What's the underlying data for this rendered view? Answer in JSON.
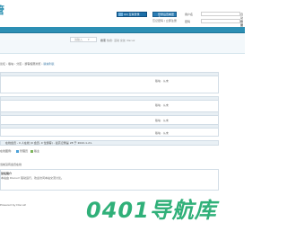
{
  "header": {
    "logo_char": "管",
    "qq_login_label": "QQ 互联登录",
    "mobile_label": "登录后查看更多",
    "small_links": "忘记密码 / 立即注册",
    "username_label": "用户名",
    "password_label": "密码",
    "remember_label": "自动登录",
    "forgot_label": "找回密码"
  },
  "subbar": {
    "search_placeholder": "请输入",
    "search_button": "搜索",
    "hot_label": "热搜:",
    "hot_terms": "活动 交友 discuz"
  },
  "breadcrumb": {
    "path": "论坛 › 版块 › 分区 › 游客权限浏览 ›",
    "current": "版块列表"
  },
  "forum_rows": [
    {
      "meta": "版块 ·   从未"
    },
    {
      "meta": "版块 ·   从未"
    },
    {
      "meta": "版块 ·   从未"
    },
    {
      "meta": "版块 ·   从未"
    }
  ],
  "stats": {
    "online_line": "在线会员 - 0 人在线 (0 会员, 0 位游客) - 最高记录是 28 于 2022-1-21.",
    "legend_label": "在线图例:",
    "legend_items": [
      {
        "label": "管理员",
        "color": "#4aa0d8"
      },
      {
        "label": "版主",
        "color": "#7cb45a"
      }
    ]
  },
  "section_label": "当前没有会员在线",
  "description": {
    "title": "论坛简介",
    "text": "本站由 Discuz! 驱动运行，欢迎访问本站交流讨论。"
  },
  "footer": {
    "text": "Powered by Discuz!"
  },
  "watermark": {
    "text": "0401导航库"
  }
}
